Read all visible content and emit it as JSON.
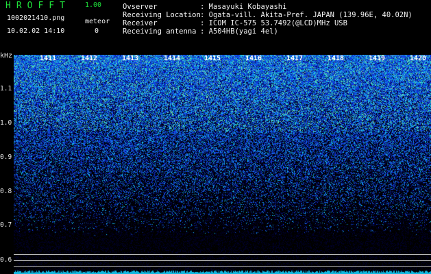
{
  "header": {
    "app_name": "HROFFT",
    "version": "1.00",
    "file_name": "1002021410.png",
    "datetime": "10.02.02 14:10",
    "meteor_label": "meteor",
    "meteor_count": "0"
  },
  "info": [
    {
      "key": "Ovserver",
      "value": ": Masayuki Kobayashi"
    },
    {
      "key": "Receiving Location",
      "value": ": Ogata-vill. Akita-Pref. JAPAN (139.96E, 40.02N)"
    },
    {
      "key": "Receiver",
      "value": ": ICOM IC-575 53.7492(@LCD)MHz USB"
    },
    {
      "key": "Receiving antenna",
      "value": ": A504HB(yagi 4el)"
    }
  ],
  "y_axis": {
    "unit": "kHz",
    "labels": [
      "1.1",
      "1.0",
      "0.9",
      "0.8",
      "0.7",
      "0.6"
    ]
  },
  "x_axis": {
    "labels": [
      "1411",
      "1412",
      "1413",
      "1414",
      "1415",
      "1416",
      "1417",
      "1418",
      "1419",
      "1420"
    ]
  },
  "colors": {
    "background": "#000000",
    "title_green": "#1fe33b",
    "noise_blue": "#1c45ff",
    "noise_cyan": "#25d0ff",
    "noise_green": "#58ff7a"
  }
}
